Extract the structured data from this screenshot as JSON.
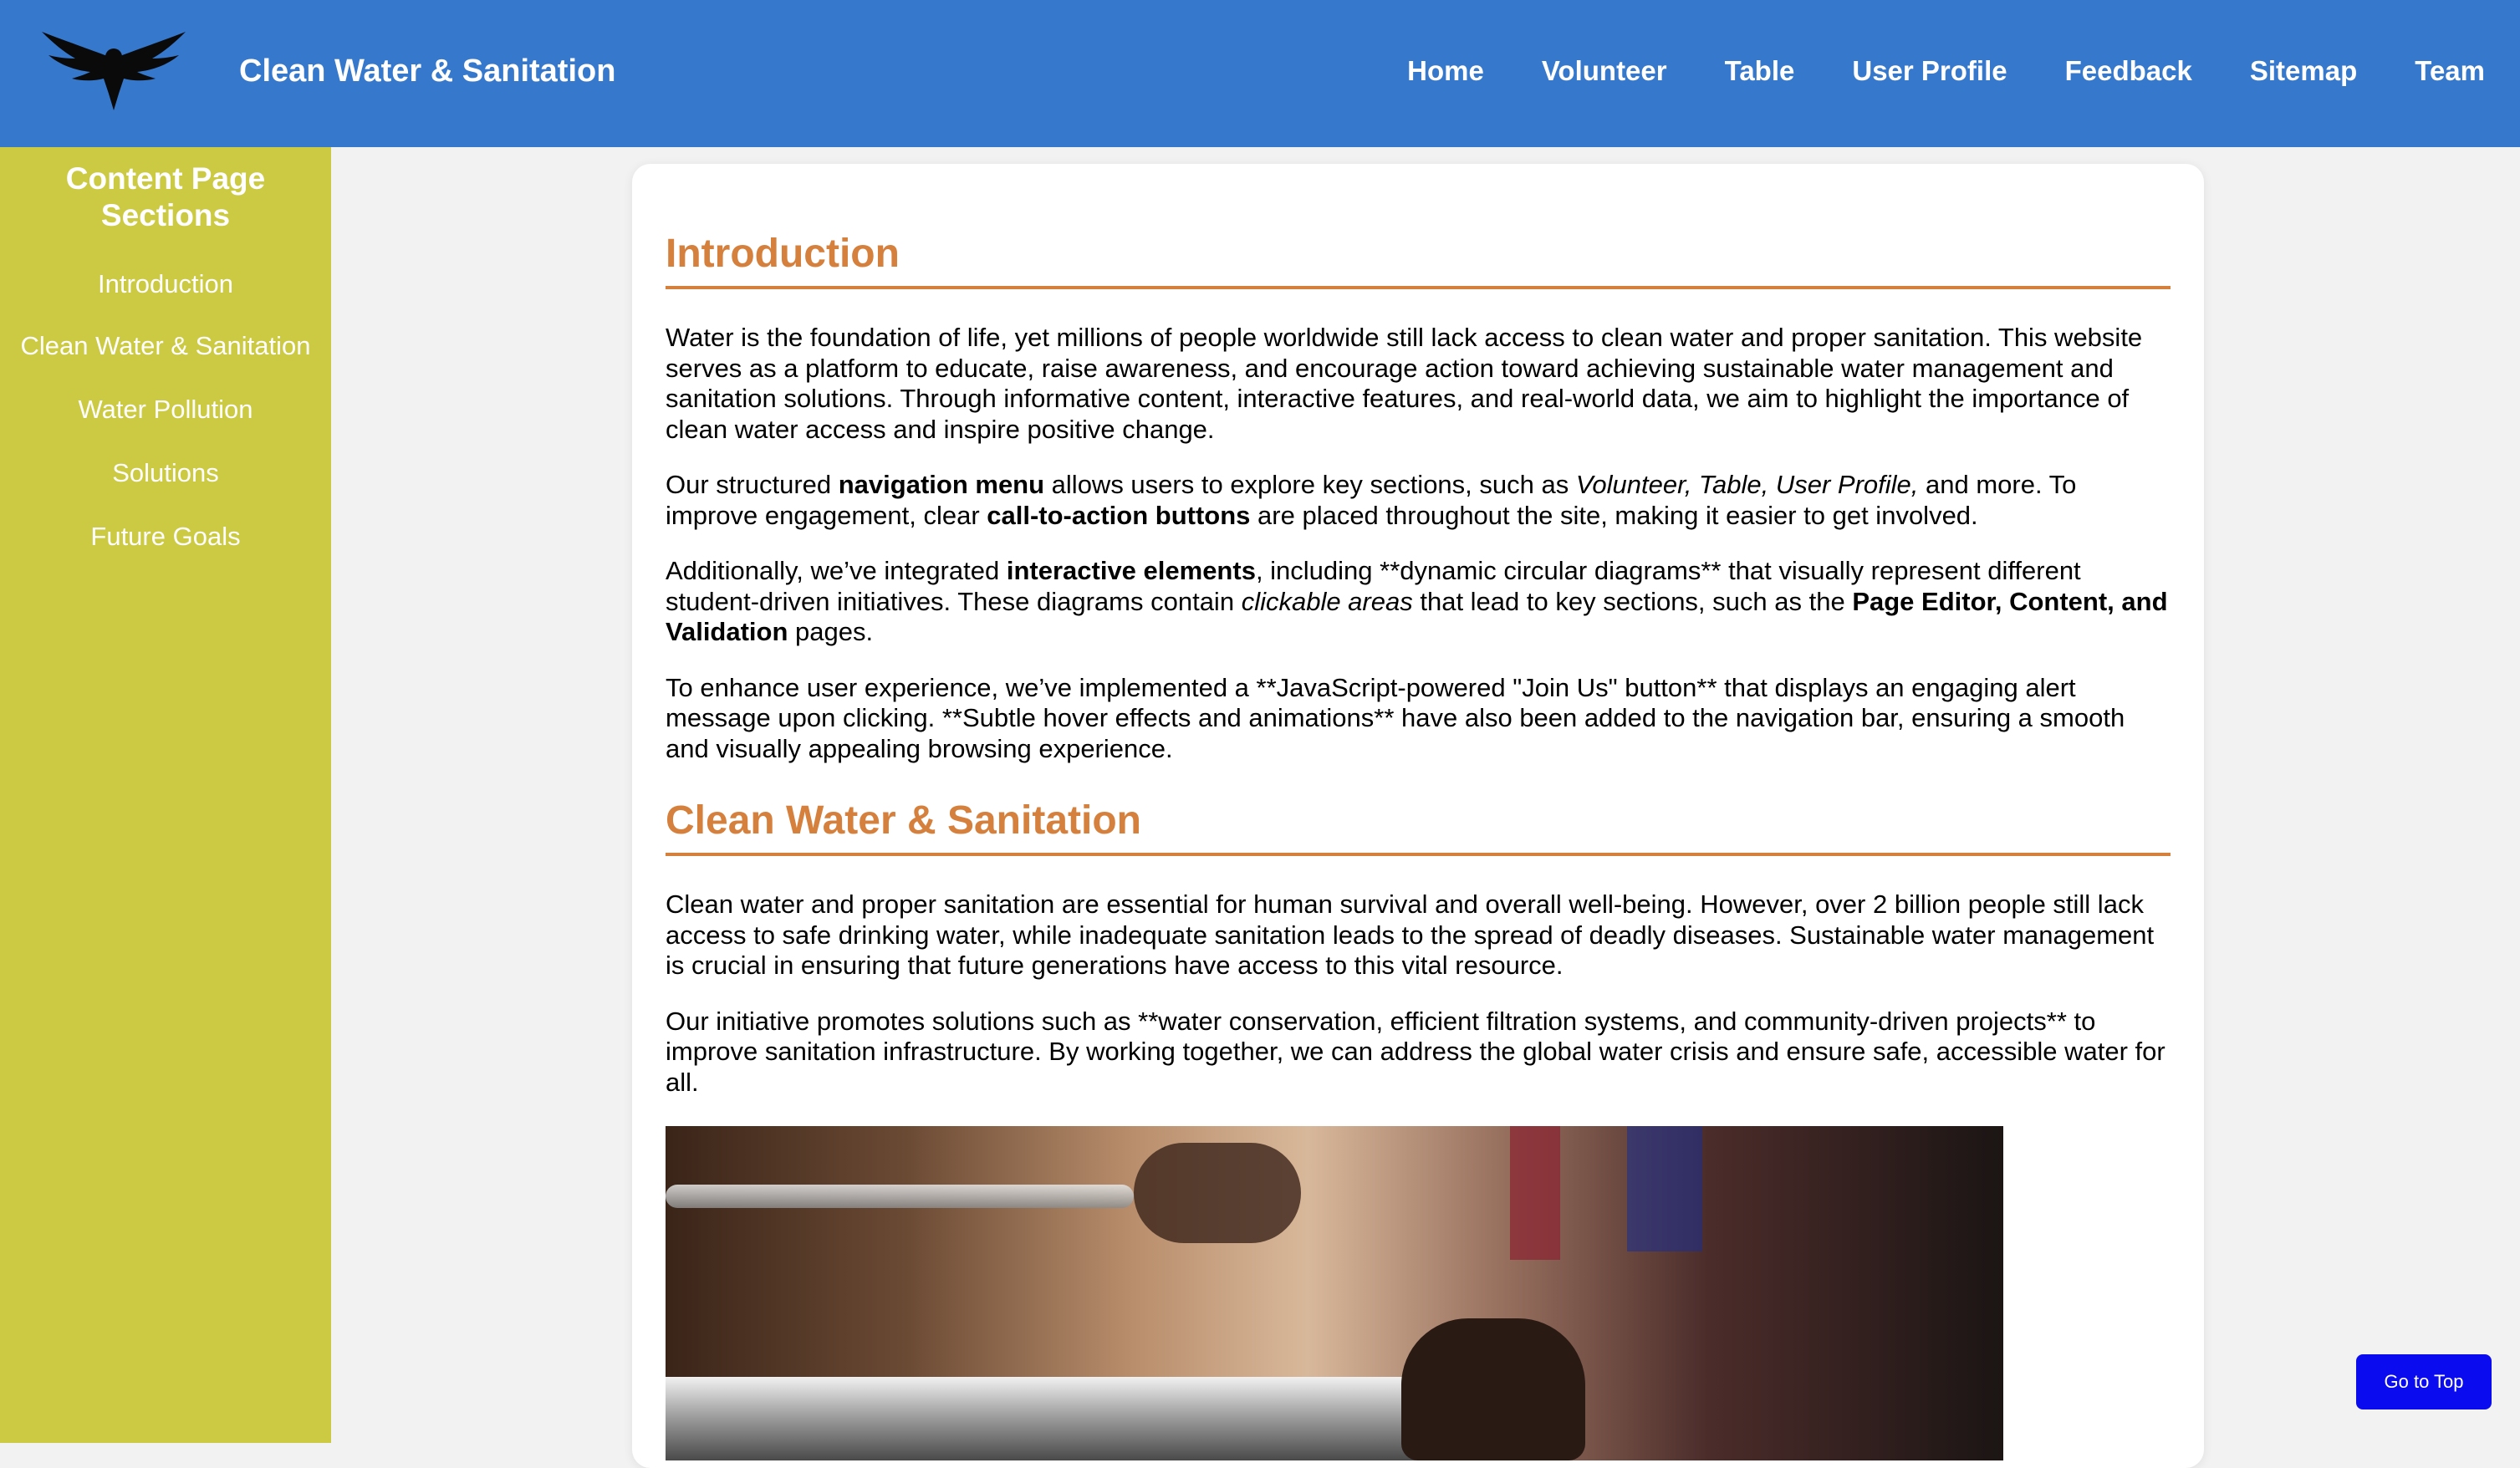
{
  "header": {
    "logo_icon": "eagle-logo-icon",
    "site_title": "Clean Water & Sanitation",
    "nav": [
      "Home",
      "Volunteer",
      "Table",
      "User Profile",
      "Feedback",
      "Sitemap",
      "Team"
    ]
  },
  "sidebar": {
    "title": "Content Page Sections",
    "items": [
      "Introduction",
      "Clean Water & Sanitation",
      "Water Pollution",
      "Solutions",
      "Future Goals"
    ]
  },
  "sections": {
    "intro": {
      "heading": "Introduction",
      "p1": "Water is the foundation of life, yet millions of people worldwide still lack access to clean water and proper sanitation. This website serves as a platform to educate, raise awareness, and encourage action toward achieving sustainable water management and sanitation solutions. Through informative content, interactive features, and real-world data, we aim to highlight the importance of clean water access and inspire positive change.",
      "p2": {
        "t1": "Our structured ",
        "b1": "navigation menu",
        "t2": " allows users to explore key sections, such as ",
        "i1": "Volunteer, Table, User Profile,",
        "t3": " and more. To improve engagement, clear ",
        "b2": "call-to-action buttons",
        "t4": " are placed throughout the site, making it easier to get involved."
      },
      "p3": {
        "t1": "Additionally, we’ve integrated ",
        "b1": "interactive elements",
        "t2": ", including **dynamic circular diagrams** that visually represent different student-driven initiatives. These diagrams contain ",
        "i1": "clickable areas",
        "t3": " that lead to key sections, such as the ",
        "b2": "Page Editor, Content, and Validation",
        "t4": " pages."
      },
      "p4": "To enhance user experience, we’ve implemented a **JavaScript-powered \"Join Us\" button** that displays an engaging alert message upon clicking. **Subtle hover effects and animations** have also been added to the navigation bar, ensuring a smooth and visually appealing browsing experience."
    },
    "clean_water": {
      "heading": "Clean Water & Sanitation",
      "p1": "Clean water and proper sanitation are essential for human survival and overall well-being. However, over 2 billion people still lack access to safe drinking water, while inadequate sanitation leads to the spread of deadly diseases. Sustainable water management is crucial in ensuring that future generations have access to this vital resource.",
      "p2": "Our initiative promotes solutions such as **water conservation, efficient filtration systems, and community-driven projects** to improve sanitation infrastructure. By working together, we can address the global water crisis and ensure safe, accessible water for all."
    }
  },
  "go_top_label": "Go to Top"
}
